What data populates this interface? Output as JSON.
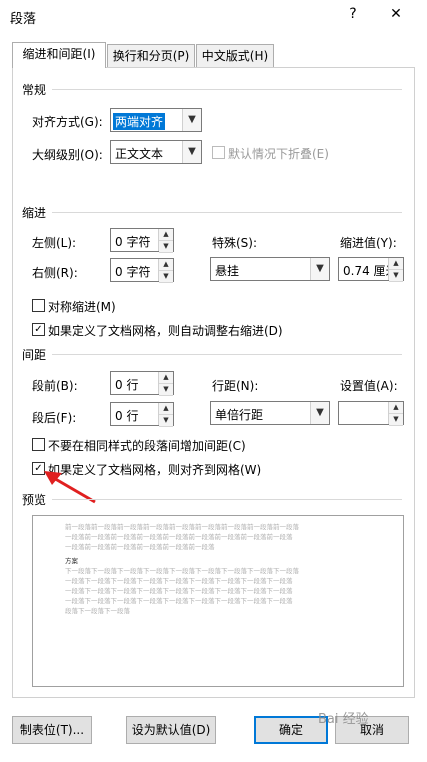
{
  "window": {
    "title": "段落",
    "help": "?",
    "close": "✕"
  },
  "tabs": [
    {
      "label": "缩进和间距(I)",
      "active": true
    },
    {
      "label": "换行和分页(P)",
      "active": false
    },
    {
      "label": "中文版式(H)",
      "active": false
    }
  ],
  "general": {
    "heading": "常规",
    "alignment_label": "对齐方式(G):",
    "alignment_value": "两端对齐",
    "outline_label": "大纲级别(O):",
    "outline_value": "正文文本",
    "collapse_label": "默认情况下折叠(E)"
  },
  "indent": {
    "heading": "缩进",
    "left_label": "左侧(L):",
    "left_value": "0 字符",
    "right_label": "右侧(R):",
    "right_value": "0 字符",
    "special_label": "特殊(S):",
    "special_value": "悬挂",
    "by_label": "缩进值(Y):",
    "by_value": "0.74 厘米",
    "mirror_label": "对称缩进(M)",
    "auto_adjust_label": "如果定义了文档网格，则自动调整右缩进(D)"
  },
  "spacing": {
    "heading": "间距",
    "before_label": "段前(B):",
    "before_value": "0 行",
    "after_label": "段后(F):",
    "after_value": "0 行",
    "line_label": "行距(N):",
    "line_value": "单倍行距",
    "at_label": "设置值(A):",
    "at_value": "",
    "no_space_label": "不要在相同样式的段落间增加间距(C)",
    "snap_grid_label": "如果定义了文档网格，则对齐到网格(W)"
  },
  "preview": {
    "heading": "预览",
    "prev_lines": [
      "前一段落前一段落前一段落前一段落前一段落前一段落前一段落前一段落前一段落",
      "一段落前一段落前一段落前一段落前一段落前一段落前一段落前一段落前一段落",
      "一段落前一段落前一段落前一段落前一段落前一段落"
    ],
    "main": "方案",
    "next_lines": [
      "下一段落下一段落下一段落下一段落下一段落下一段落下一段落下一段落下一段落",
      "一段落下一段落下一段落下一段落下一段落下一段落下一段落下一段落下一段落",
      "一段落下一段落下一段落下一段落下一段落下一段落下一段落下一段落下一段落",
      "一段落下一段落下一段落下一段落下一段落下一段落下一段落下一段落下一段落",
      "段落下一段落下一段落"
    ]
  },
  "buttons": {
    "tabs": "制表位(T)...",
    "default": "设为默认值(D)",
    "ok": "确定",
    "cancel": "取消"
  },
  "colors": {
    "accent": "#0078d7",
    "annotation_arrow": "#e02020"
  },
  "watermark": "Bai 经验"
}
